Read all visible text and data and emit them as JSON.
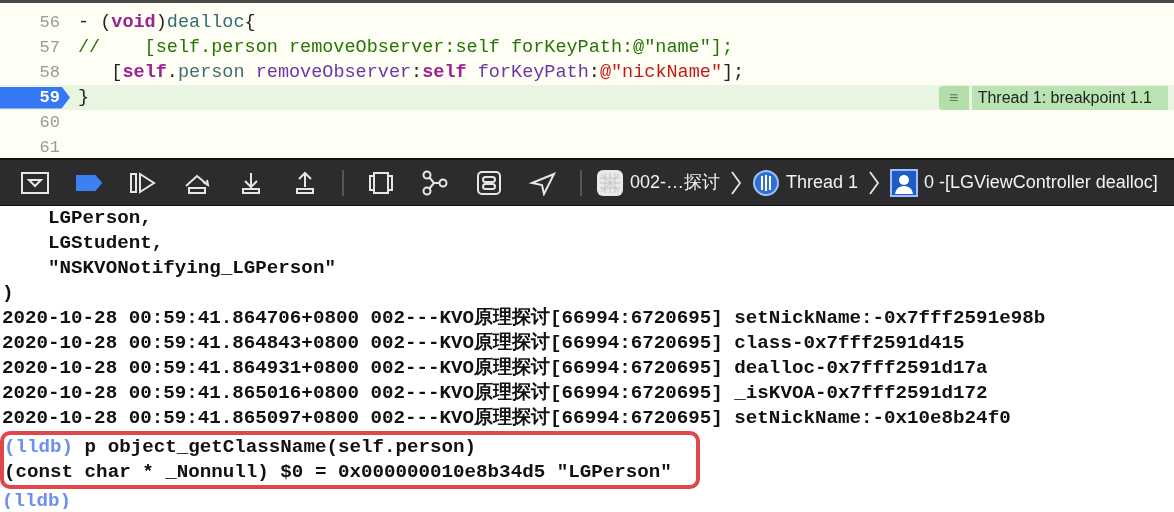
{
  "editor": {
    "lines": [
      {
        "number": "56",
        "current": false,
        "tokens": [
          {
            "kind": "plain",
            "text": "- ("
          },
          {
            "kind": "keyword",
            "text": "void"
          },
          {
            "kind": "plain",
            "text": ")"
          },
          {
            "kind": "method",
            "text": "dealloc"
          },
          {
            "kind": "plain",
            "text": "{"
          }
        ]
      },
      {
        "number": "57",
        "current": false,
        "tokens": [
          {
            "kind": "comment",
            "text": "//    [self.person removeObserver:self forKeyPath:@\"name\"];"
          }
        ]
      },
      {
        "number": "58",
        "current": false,
        "tokens": [
          {
            "kind": "plain",
            "text": "   ["
          },
          {
            "kind": "keyword",
            "text": "self"
          },
          {
            "kind": "plain",
            "text": "."
          },
          {
            "kind": "property",
            "text": "person"
          },
          {
            "kind": "selector",
            "text": " removeObserver"
          },
          {
            "kind": "plain",
            "text": ":"
          },
          {
            "kind": "keyword",
            "text": "self"
          },
          {
            "kind": "selector",
            "text": " forKeyPath"
          },
          {
            "kind": "plain",
            "text": ":"
          },
          {
            "kind": "string",
            "text": "@\"nickName\""
          },
          {
            "kind": "plain",
            "text": "];"
          }
        ]
      },
      {
        "number": "59",
        "current": true,
        "tokens": [
          {
            "kind": "plain",
            "text": "}"
          }
        ],
        "annotation": {
          "icon": "≡",
          "text": "Thread 1: breakpoint 1.1"
        }
      },
      {
        "number": "60",
        "current": false
      },
      {
        "number": "61",
        "current": false
      }
    ]
  },
  "debug_bar": {
    "buttons": [
      {
        "kind": "console-toggle"
      },
      {
        "kind": "breakpoints",
        "active": true
      },
      {
        "kind": "continue"
      },
      {
        "kind": "step-over"
      },
      {
        "kind": "step-into"
      },
      {
        "kind": "step-out"
      },
      {
        "kind": "separator"
      },
      {
        "kind": "view-hierarchy"
      },
      {
        "kind": "memory-graph"
      },
      {
        "kind": "environment"
      },
      {
        "kind": "location"
      },
      {
        "kind": "separator"
      }
    ],
    "breadcrumb": [
      {
        "kind": "app",
        "text": "002-…探讨"
      },
      {
        "kind": "thread",
        "text": "Thread 1"
      },
      {
        "kind": "frame",
        "text": "0 -[LGViewController dealloc]"
      }
    ]
  },
  "console": {
    "lines": [
      {
        "kind": "output",
        "text": "    LGPerson,",
        "highlighted": false
      },
      {
        "kind": "output",
        "text": "    LGStudent,",
        "highlighted": false
      },
      {
        "kind": "output",
        "text": "    \"NSKVONotifying_LGPerson\"",
        "highlighted": false
      },
      {
        "kind": "output",
        "text": ")",
        "highlighted": false
      },
      {
        "kind": "output",
        "text": "2020-10-28 00:59:41.864706+0800 002---KVO原理探讨[66994:6720695] setNickName:-0x7fff2591e98b",
        "highlighted": false
      },
      {
        "kind": "output",
        "text": "2020-10-28 00:59:41.864843+0800 002---KVO原理探讨[66994:6720695] class-0x7fff2591d415",
        "highlighted": false
      },
      {
        "kind": "output",
        "text": "2020-10-28 00:59:41.864931+0800 002---KVO原理探讨[66994:6720695] dealloc-0x7fff2591d17a",
        "highlighted": false
      },
      {
        "kind": "output",
        "text": "2020-10-28 00:59:41.865016+0800 002---KVO原理探讨[66994:6720695] _isKVOA-0x7fff2591d172",
        "highlighted": false
      },
      {
        "kind": "output",
        "text": "2020-10-28 00:59:41.865097+0800 002---KVO原理探讨[66994:6720695] setNickName:-0x10e8b24f0",
        "highlighted": false
      },
      {
        "kind": "command",
        "prompt": "(lldb)",
        "text": "p object_getClassName(self.person)",
        "highlighted": true
      },
      {
        "kind": "output",
        "text": "(const char * _Nonnull) $0 = 0x000000010e8b34d5 \"LGPerson\"",
        "highlighted": true
      },
      {
        "kind": "command",
        "prompt": "(lldb)",
        "highlighted": false
      }
    ]
  }
}
